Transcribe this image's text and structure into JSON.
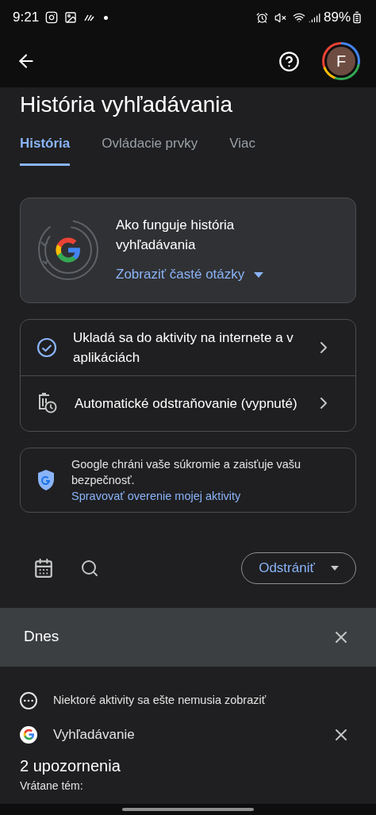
{
  "status_bar": {
    "time": "9:21",
    "battery": "89%"
  },
  "app_bar": {
    "avatar_letter": "F"
  },
  "title": "História vyhľadávania",
  "tabs": [
    {
      "label": "História",
      "selected": true
    },
    {
      "label": "Ovládacie prvky",
      "selected": false
    },
    {
      "label": "Viac",
      "selected": false
    }
  ],
  "info_card": {
    "title": "Ako funguje história vyhľadávania",
    "link": "Zobraziť časté otázky"
  },
  "settings": [
    {
      "kind": "check",
      "label": "Ukladá sa do aktivity na internete a v aplikáciách"
    },
    {
      "kind": "autodelete",
      "label": "Automatické odstraňovanie (vypnuté)"
    }
  ],
  "privacy_card": {
    "text": "Google chráni vaše súkromie a zaisťuje vašu bezpečnosť.",
    "link": "Spravovať overenie mojej aktivity"
  },
  "delete_button": "Odstrániť",
  "day_header": "Dnes",
  "notice": "Niektoré aktivity sa ešte nemusia zobraziť",
  "activity": {
    "label": "Vyhľadávanie"
  },
  "alerts_heading": "2 upozornenia",
  "alerts_subheading": "Vrátane tém:"
}
